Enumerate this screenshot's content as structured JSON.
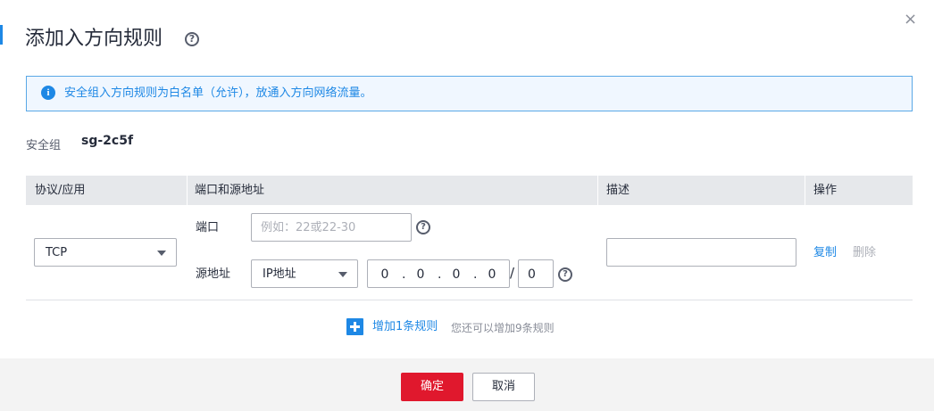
{
  "dialog": {
    "title": "添加入方向规则",
    "close_glyph": "×",
    "help_glyph": "?"
  },
  "notice": {
    "icon": "info-icon",
    "icon_glyph": "i",
    "text": "安全组入方向规则为白名单（允许），放通入方向网络流量。"
  },
  "security_group": {
    "label": "安全组",
    "value": "sg-2c5f"
  },
  "table": {
    "headers": [
      "协议/应用",
      "端口和源地址",
      "描述",
      "操作"
    ]
  },
  "rule": {
    "protocol": "TCP",
    "port_label": "端口",
    "port_placeholder": "例如：22或22-30",
    "port_value": "",
    "source_label": "源地址",
    "source_type": "IP地址",
    "ip_octets": [
      "0",
      "0",
      "0",
      "0"
    ],
    "ip_dot": ".",
    "mask_separator": "/",
    "mask": "0",
    "description_value": "",
    "copy_label": "复制",
    "delete_label": "删除"
  },
  "add_rule": {
    "label": "增加1条规则",
    "hint": "您还可以增加9条规则"
  },
  "footer": {
    "confirm_label": "确定",
    "cancel_label": "取消"
  },
  "colors": {
    "accent": "#1e88e5",
    "confirm": "#e0182d"
  }
}
